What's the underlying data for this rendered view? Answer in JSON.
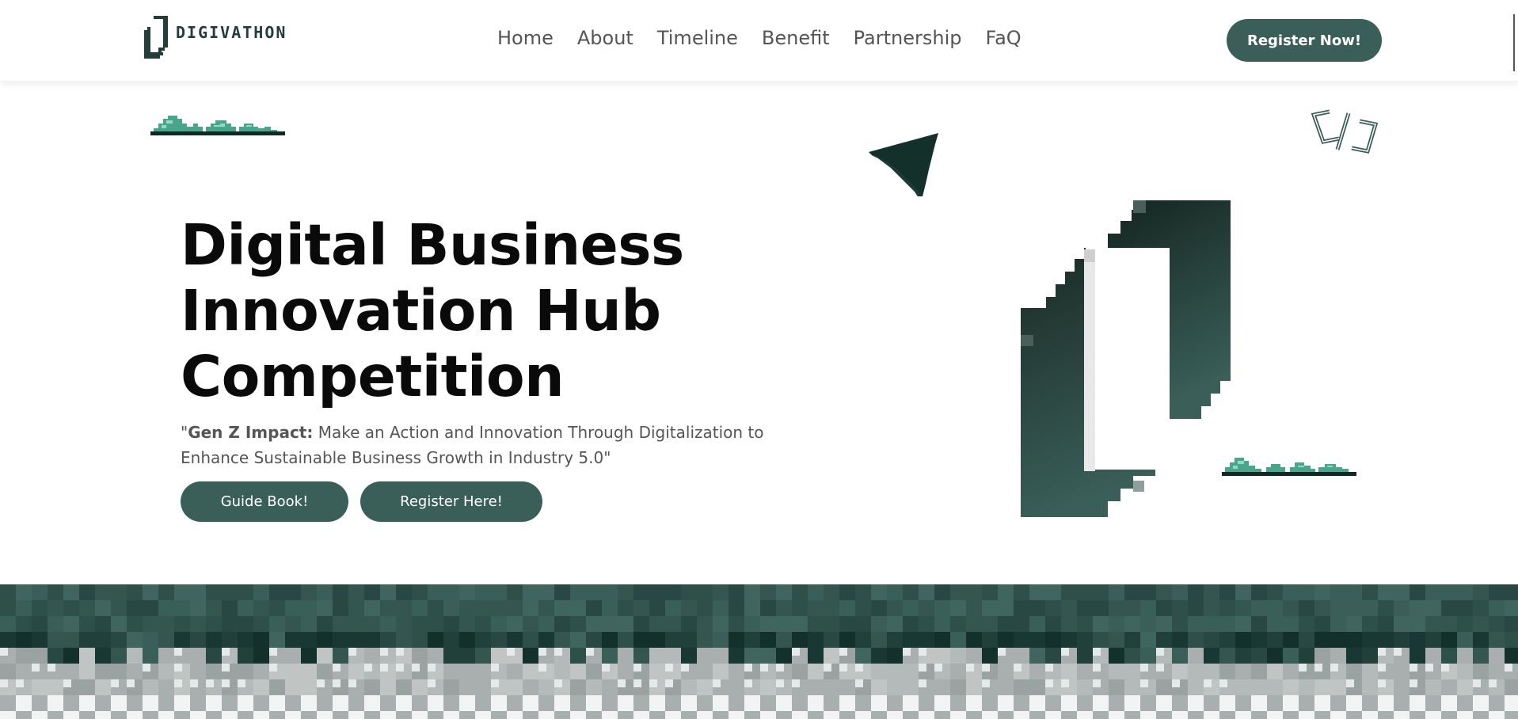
{
  "brand": {
    "name": "DIGIVATHON",
    "accent_color": "#3a5e58",
    "dark_color": "#14302b"
  },
  "nav": {
    "items": [
      "Home",
      "About",
      "Timeline",
      "Benefit",
      "Partnership",
      "FaQ"
    ],
    "cta_label": "Register Now!"
  },
  "hero": {
    "title_lines": [
      "Digital Business",
      "Innovation Hub",
      "Competition"
    ],
    "subtitle_open_quote": "\"",
    "subtitle_bold": "Gen Z Impact:",
    "subtitle_rest": " Make an Action and Innovation Through Digitalization to Enhance Sustainable Business Growth in Industry 5.0\"",
    "buttons": {
      "guide_label": "Guide Book!",
      "register_label": "Register Here!"
    }
  },
  "decorations": {
    "icons": [
      "bush-icon",
      "paper-plane-icon",
      "code-brackets-icon",
      "logo-mark-icon",
      "pixel-terrain"
    ]
  }
}
